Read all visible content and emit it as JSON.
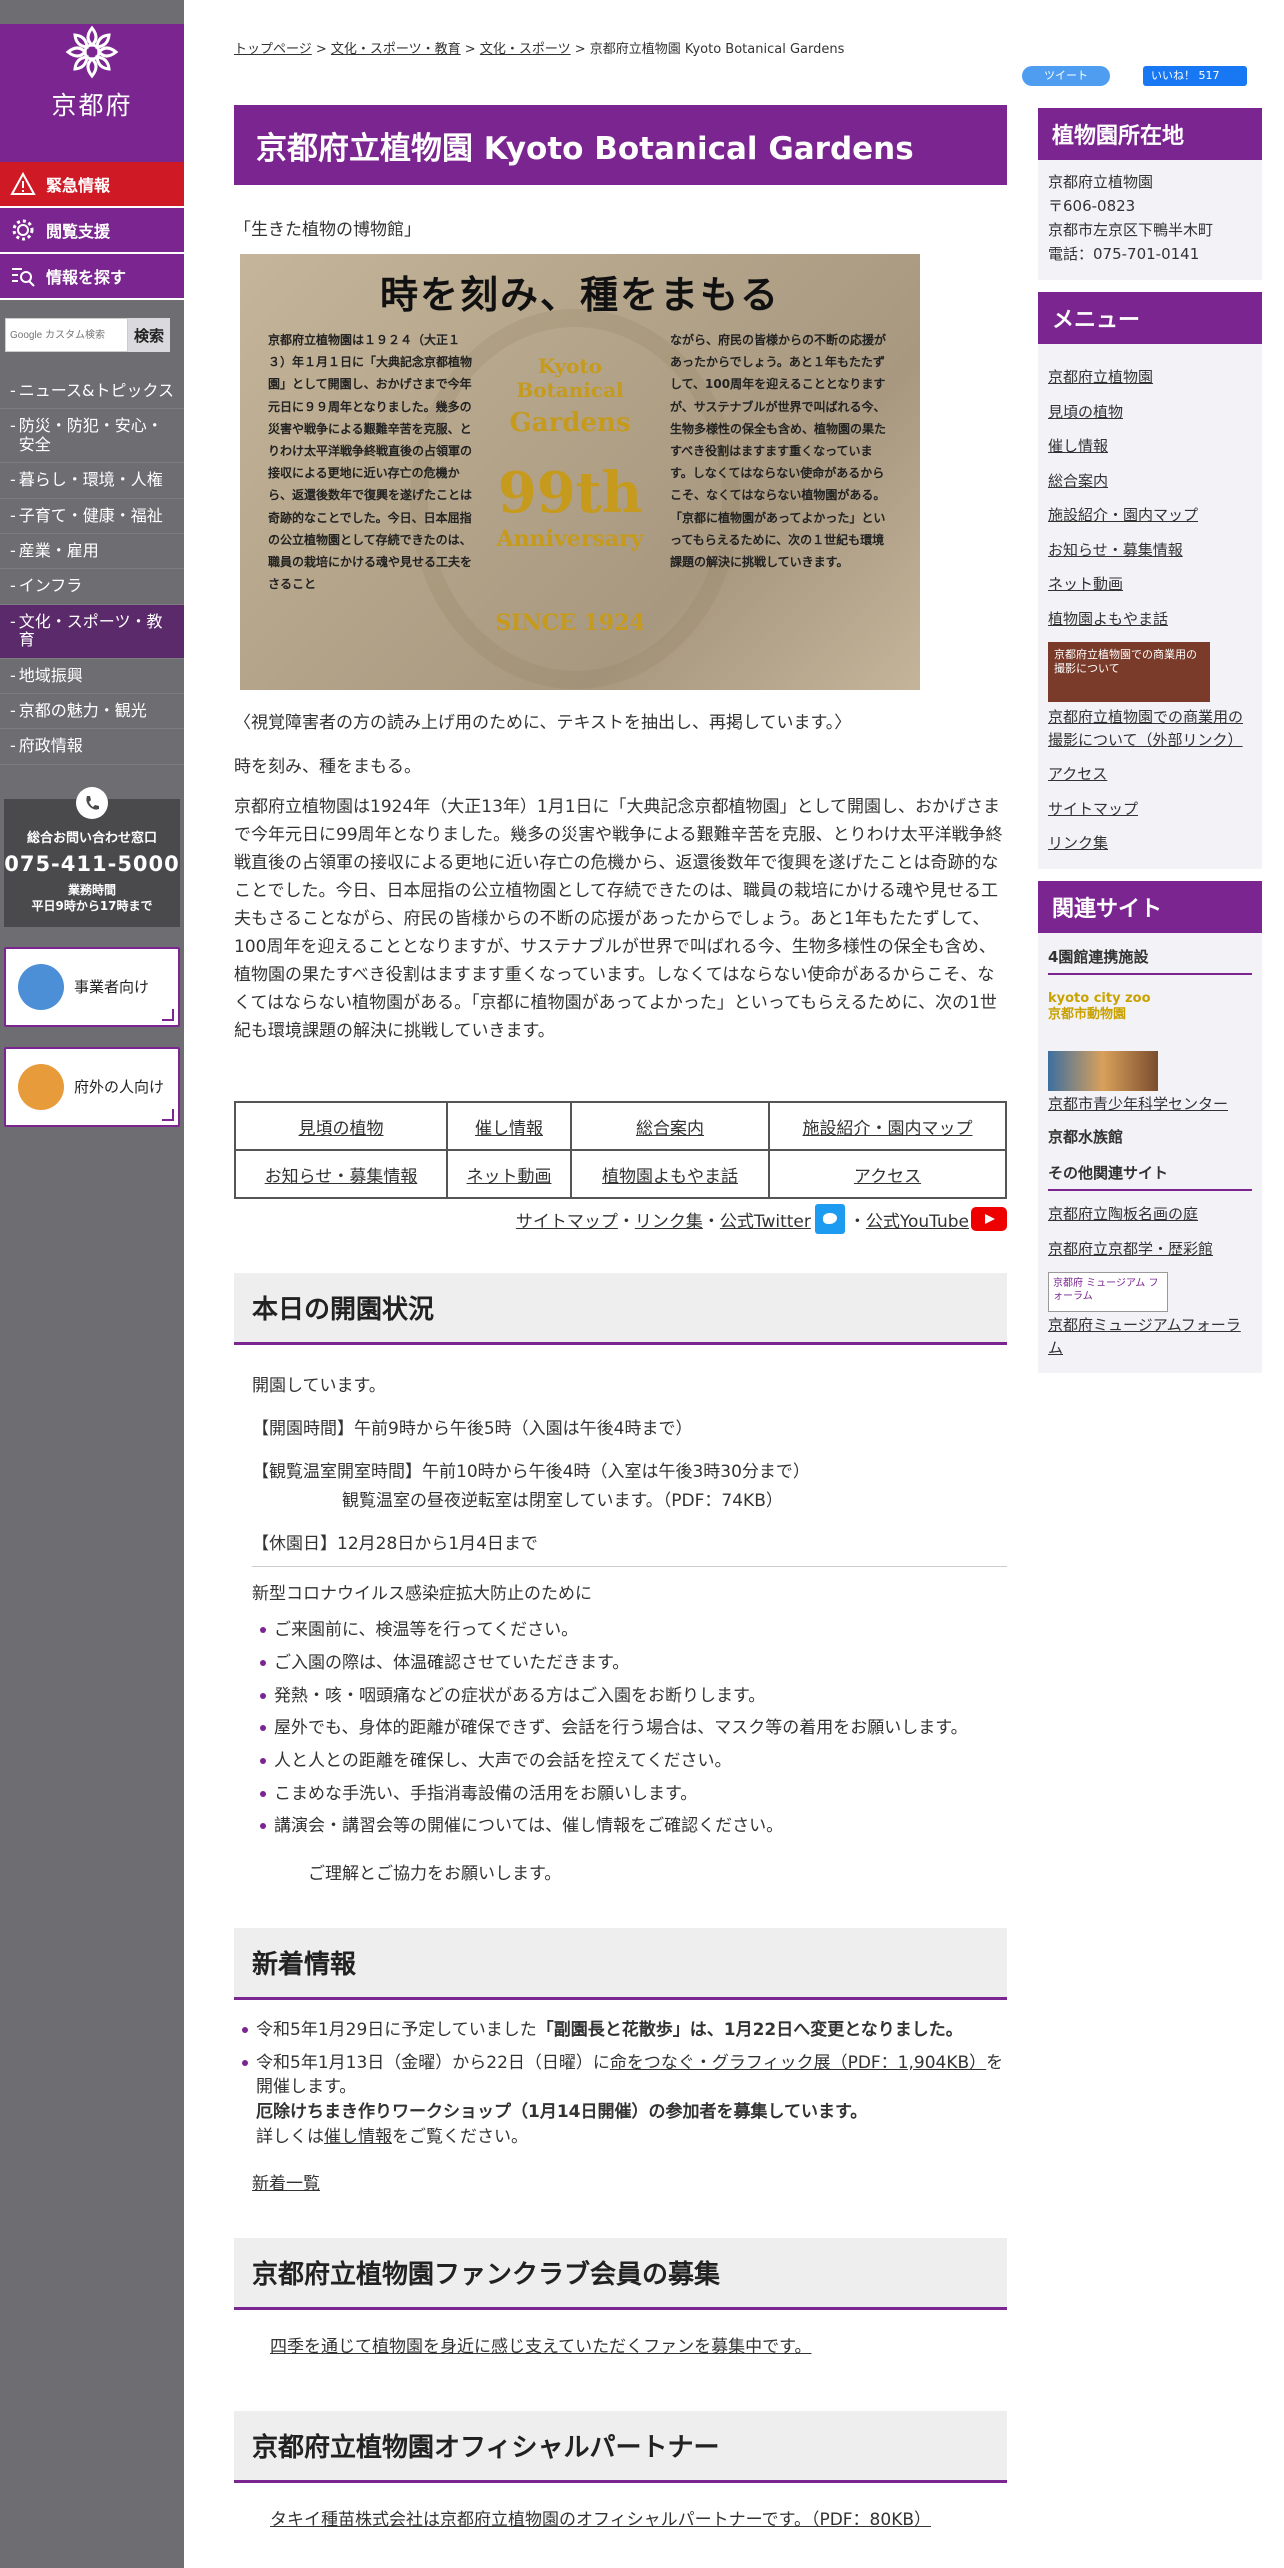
{
  "site": {
    "name": "京都府",
    "brand_color": "#7b2590",
    "alert_color": "#cf1a26"
  },
  "side_buttons": [
    {
      "label": "緊急情報",
      "icon": "warning-icon"
    },
    {
      "label": "閲覧支援",
      "icon": "gear-icon"
    },
    {
      "label": "情報を探す",
      "icon": "search-list-icon"
    }
  ],
  "search": {
    "placeholder": "Google カスタム検索",
    "button": "検索"
  },
  "nav": [
    "ニュース&トピックス",
    "防災・防犯・安心・安全",
    "暮らし・環境・人権",
    "子育て・健康・福祉",
    "産業・雇用",
    "インフラ",
    "文化・スポーツ・教育",
    "地域振興",
    "京都の魅力・観光",
    "府政情報"
  ],
  "contact": {
    "title": "総合お問い合わせ窓口",
    "phone": "075-411-5000",
    "hours_label": "業務時間",
    "hours": "平日9時から17時まで"
  },
  "audience": {
    "business": "事業者向け",
    "outside": "府外の人向け"
  },
  "breadcrumb": {
    "top": "トップページ",
    "c1": "文化・スポーツ・教育",
    "c2": "文化・スポーツ",
    "current": "京都府立植物園 Kyoto Botanical Gardens"
  },
  "social": {
    "tweet": "ツイート",
    "like": "いいね！ 517"
  },
  "page_title": "京都府立植物園 Kyoto Botanical Gardens",
  "lead": "「生きた植物の博物館」",
  "poster": {
    "title": "時を刻み、種をまもる",
    "left": "京都府立植物園は１９２４（大正１３）年１月１日に「大典記念京都植物園」として開園し、おかげさまで今年元日に９９周年となりました。幾多の災害や戦争による艱難辛苦を克服、とりわけ太平洋戦争終戦直後の占領軍の接収による更地に近い存亡の危機から、返還後数年で復興を遂げたことは奇跡的なことでした。今日、日本屈指の公立植物園として存続できたのは、職員の栽培にかける魂や見せる工夫をさること",
    "right": "ながら、府民の皆様からの不断の応援があったからでしょう。あと１年もたたずして、100周年を迎えることとなりますが、サステナブルが世界で叫ばれる今、生物多様性の保全も含め、植物園の果たすべき役割はますます重くなっています。しなくてはならない使命があるからこそ、なくてはならない植物園がある。「京都に植物園があってよかった」といってもらえるために、次の１世紀も環境課題の解決に挑戦していきます。",
    "center1": "Kyoto Botanical",
    "center2": "Gardens",
    "years": "99th",
    "anniv": "Anniversary",
    "since": "SINCE 1924"
  },
  "caption": "〈視覚障害者の方の読み上げ用のために、テキストを抽出し、再掲しています。〉",
  "subtitle": "時を刻み、種をまもる。",
  "body": "京都府立植物園は1924年（大正13年）1月1日に「大典記念京都植物園」として開園し、おかげさまで今年元日に99周年となりました。幾多の災害や戦争による艱難辛苦を克服、とりわけ太平洋戦争終戦直後の占領軍の接収による更地に近い存亡の危機から、返還後数年で復興を遂げたことは奇跡的なことでした。今日、日本屈指の公立植物園として存続できたのは、職員の栽培にかける魂や見せる工夫もさることながら、府民の皆様からの不断の応援があったからでしょう。あと1年もたたずして、100周年を迎えることとなりますが、サステナブルが世界で叫ばれる今、生物多様性の保全も含め、植物園の果たすべき役割はますます重くなっています。しなくてはならない使命があるからこそ、なくてはならない植物園がある。「京都に植物園があってよかった」といってもらえるために、次の1世紀も環境課題の解決に挑戦していきます。",
  "link_table": [
    [
      "見頃の植物",
      "催し情報",
      "総合案内",
      "施設紹介・園内マップ"
    ],
    [
      "お知らせ・募集情報",
      "ネット動画",
      "植物園よもやま話",
      "アクセス"
    ]
  ],
  "sublinks": {
    "sitemap": "サイトマップ",
    "links": "リンク集",
    "twitter": "公式Twitter",
    "youtube": "公式YouTube",
    "dot": "・"
  },
  "status": {
    "heading": "本日の開園状況",
    "open": "開園しています。",
    "hours": "【開園時間】午前9時から午後5時（入園は午後4時まで）",
    "greenhouse": "【観覧温室開室時間】午前10時から午後4時（入室は午後3時30分まで）",
    "greenhouse_link": "観覧温室の昼夜逆転室は閉室しています。（PDF：74KB）",
    "closed": "【休園日】12月28日から1月4日まで",
    "covid_title": "新型コロナウイルス感染症拡大防止のために",
    "covid": [
      "ご来園前に、検温等を行ってください。",
      "ご入園の際は、体温確認させていただきます。",
      "発熱・咳・咽頭痛などの症状がある方はご入園をお断りします。",
      "屋外でも、身体的距離が確保できず、会話を行う場合は、マスク等の着用をお願いします。",
      "人と人との距離を確保し、大声での会話を控えてください。",
      "こまめな手洗い、手指消毒設備の活用をお願いします。",
      "講演会・講習会等の開催については、催し情報をご確認ください。"
    ],
    "thanks": "ご理解とご協力をお願いします。"
  },
  "news": {
    "heading": "新着情報",
    "i1a": "令和5年1月29日に予定していました",
    "i1b": "「副園長と花散歩」は、1月22日へ変更となりました。",
    "i2a": "令和5年1月13日（金曜）から22日（日曜）に",
    "i2link": "命をつなぐ・グラフィック展（PDF：1,904KB）",
    "i2b": "を開催します。",
    "ws": "厄除けちまき作りワークショップ（1月14日開催）の参加者を募集しています。",
    "detail_a": "詳しくは",
    "detail_link": "催し情報",
    "detail_b": "をご覧ください。",
    "all": "新着一覧"
  },
  "fanclub": {
    "heading": "京都府立植物園ファンクラブ会員の募集",
    "text": "四季を通じて植物園を身近に感じ支えていただくファンを募集中です。"
  },
  "partner": {
    "heading": "京都府立植物園オフィシャルパートナー",
    "text": "タキイ種苗株式会社は京都府立植物園のオフィシャルパートナーです。（PDF：80KB）"
  },
  "right": {
    "loc_heading": "植物園所在地",
    "loc": [
      "京都府立植物園",
      "〒606-0823",
      "京都市左京区下鴨半木町",
      "電話：075-701-0141"
    ],
    "menu_heading": "メニュー",
    "menu": [
      "京都府立植物園",
      "見頃の植物",
      "催し情報",
      "総合案内",
      "施設紹介・園内マップ",
      "お知らせ・募集情報",
      "ネット動画",
      "植物園よもやま話"
    ],
    "banner_text": "京都府立植物園での商業用の撮影について",
    "menu_extra": "京都府立植物園での商業用の撮影について（外部リンク）",
    "menu2": [
      "アクセス",
      "サイトマップ",
      "リンク集"
    ],
    "rel_heading": "関連サイト",
    "four": "4園館連携施設",
    "zoo": "kyoto city zoo 京都市動物園",
    "science": "京都市青少年科学センター",
    "aquarium": "京都水族館",
    "other": "その他関連サイト",
    "others": [
      "京都府立陶板名画の庭",
      "京都府立京都学・歴彩館"
    ],
    "museum_logo": "京都府 ミュージアム フォーラム",
    "museum": "京都府ミュージアムフォーラム"
  }
}
